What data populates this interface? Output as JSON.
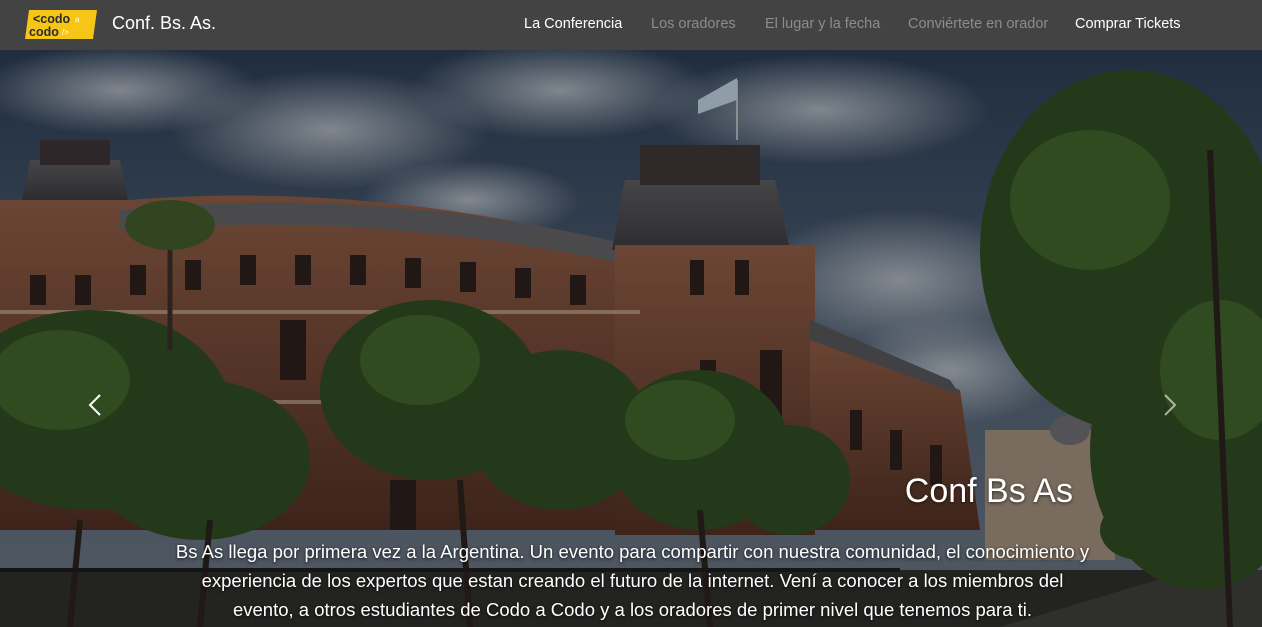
{
  "navbar": {
    "logo_line1": "<codo",
    "logo_line1_suffix": "a",
    "logo_line2": "codo",
    "logo_line2_suffix": "/>",
    "brand": "Conf. Bs. As.",
    "links": [
      {
        "label": "La Conferencia",
        "state": "active"
      },
      {
        "label": "Los oradores",
        "state": "muted"
      },
      {
        "label": "El lugar y la fecha",
        "state": "muted"
      },
      {
        "label": "Conviértete en orador",
        "state": "muted"
      },
      {
        "label": "Comprar Tickets",
        "state": "active"
      }
    ]
  },
  "hero": {
    "title": "Conf Bs As",
    "text": "Bs As llega por primera vez a la Argentina. Un evento para compartir con nuestra comunidad, el conocimiento y experiencia de los expertos que estan creando el futuro de la internet. Vení a conocer a los miembros del evento, a otros estudiantes de Codo a Codo y a los oradores de primer nivel que tenemos para ti."
  },
  "colors": {
    "navbar_bg": "#434343",
    "logo_yellow": "#f5c518",
    "nav_active": "#ffffff",
    "nav_muted": "#8c8c8c"
  },
  "icons": {
    "prev": "chevron-left-icon",
    "next": "chevron-right-icon"
  }
}
